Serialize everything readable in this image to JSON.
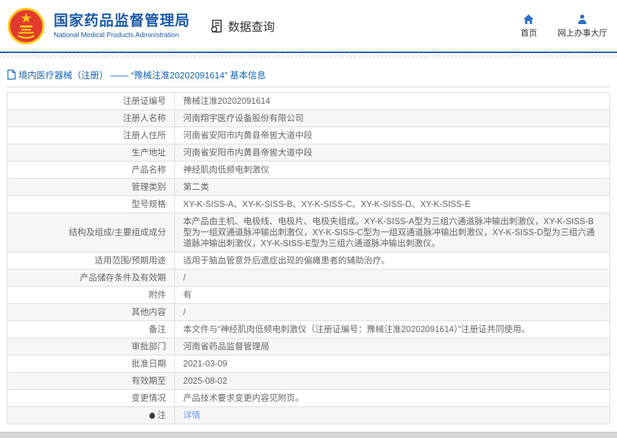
{
  "header": {
    "site_title": "国家药品监督管理局",
    "site_subtitle": "National Medical Products Administration",
    "data_query_label": "数据查询",
    "nav": [
      {
        "label": "首页",
        "icon": "home-icon"
      },
      {
        "label": "网上办事大厅",
        "icon": "user-icon"
      }
    ]
  },
  "breadcrumb": {
    "text": "境内医疗器械（注册） —— “豫械注准20202091614” 基本信息",
    "icon": "document-icon"
  },
  "table": {
    "rows": [
      {
        "label": "注册证编号",
        "value": "豫械注准20202091614"
      },
      {
        "label": "注册人名称",
        "value": "河南翔宇医疗设备股份有限公司"
      },
      {
        "label": "注册人住所",
        "value": "河南省安阳市内黄县帝喾大道中段"
      },
      {
        "label": "生产地址",
        "value": "河南省安阳市内黄县帝喾大道中段"
      },
      {
        "label": "产品名称",
        "value": "神经肌肉低频电刺激仪"
      },
      {
        "label": "管理类别",
        "value": "第二类"
      },
      {
        "label": "型号规格",
        "value": "XY-K-SISS-A、XY-K-SISS-B、XY-K-SISS-C、XY-K-SISS-D、XY-K-SISS-E"
      },
      {
        "label": "结构及组成/主要组成成分",
        "value": "本产品由主机、电极线、电极片、电极夹组成。XY-K-SISS-A型为三组六通道脉冲输出刺激仪，XY-K-SISS-B型为一组双通道脉冲输出刺激仪，XY-K-SISS-C型为一组双通道脉冲输出刺激仪，XY-K-SISS-D型为三组六通道脉冲输出刺激仪，XY-K-SISS-E型为三组六通道脉冲输出刺激仪。"
      },
      {
        "label": "适用范围/预期用途",
        "value": "适用于脑血管意外后遗症出现的偏瘫患者的辅助治疗。"
      },
      {
        "label": "产品储存条件及有效期",
        "value": "/"
      },
      {
        "label": "附件",
        "value": "有"
      },
      {
        "label": "其他内容",
        "value": "/"
      },
      {
        "label": "备注",
        "value": "本文件与“神经肌肉低频电刺激仪（注册证编号：豫械注准20202091614）”注册证共同使用。"
      },
      {
        "label": "审批部门",
        "value": "河南省药品监督管理局"
      },
      {
        "label": "批准日期",
        "value": "2021-03-09"
      },
      {
        "label": "有效期至",
        "value": "2025-08-02"
      },
      {
        "label": "变更情况",
        "value": "产品技术要求变更内容见附页。"
      },
      {
        "label": "注",
        "value": "详情",
        "link": true,
        "label_icon": "note-pin-icon"
      }
    ]
  },
  "icons": {
    "emblem": "national-emblem-icon",
    "data_query": "document-search-icon",
    "home": "home-icon",
    "online_hall": "user-icon",
    "breadcrumb": "document-icon",
    "note": "note-pin-icon"
  },
  "colors": {
    "brand_blue": "#1b5aa7",
    "icon_blue": "#2f6fc1",
    "breadcrumb_blue": "#1464b4",
    "link_blue": "#6d9cf0",
    "emblem_red": "#e23b2e",
    "emblem_gold": "#f7c917",
    "row_alt_bg": "#f6f6f6",
    "table_border": "#dddddd"
  }
}
